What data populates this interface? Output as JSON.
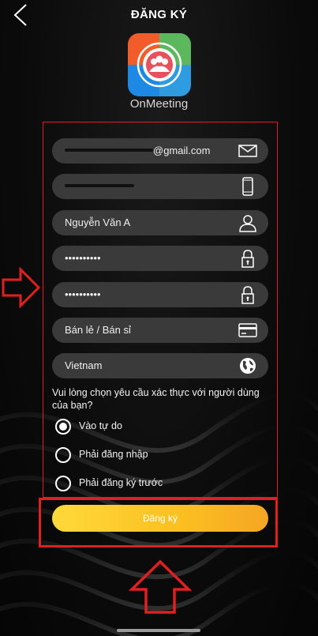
{
  "header": {
    "title": "ĐĂNG KÝ"
  },
  "app": {
    "name": "OnMeeting"
  },
  "fields": {
    "email": {
      "value": "@gmail.com",
      "icon": "mail-icon"
    },
    "phone": {
      "value": "",
      "icon": "phone-icon"
    },
    "name": {
      "value": "Nguyễn Văn A",
      "icon": "user-icon"
    },
    "password": {
      "value": "••••••••••",
      "icon": "lock-icon"
    },
    "confirm_password": {
      "value": "••••••••••",
      "icon": "lock-icon"
    },
    "business_type": {
      "value": "Bán lẻ / Bán sỉ",
      "icon": "card-icon"
    },
    "country": {
      "value": "Vietnam",
      "icon": "globe-icon"
    }
  },
  "auth": {
    "prompt": "Vui lòng chọn yêu cầu xác thực với người dùng của bạn?",
    "options": [
      {
        "label": "Vào tự do",
        "selected": true
      },
      {
        "label": "Phải đăng nhập",
        "selected": false
      },
      {
        "label": "Phải đăng ký trước",
        "selected": false
      }
    ]
  },
  "submit": {
    "label": "Đăng ký"
  },
  "colors": {
    "accent": "#fbbf20",
    "highlight": "#e02020",
    "field_bg": "#3a3a3a"
  }
}
